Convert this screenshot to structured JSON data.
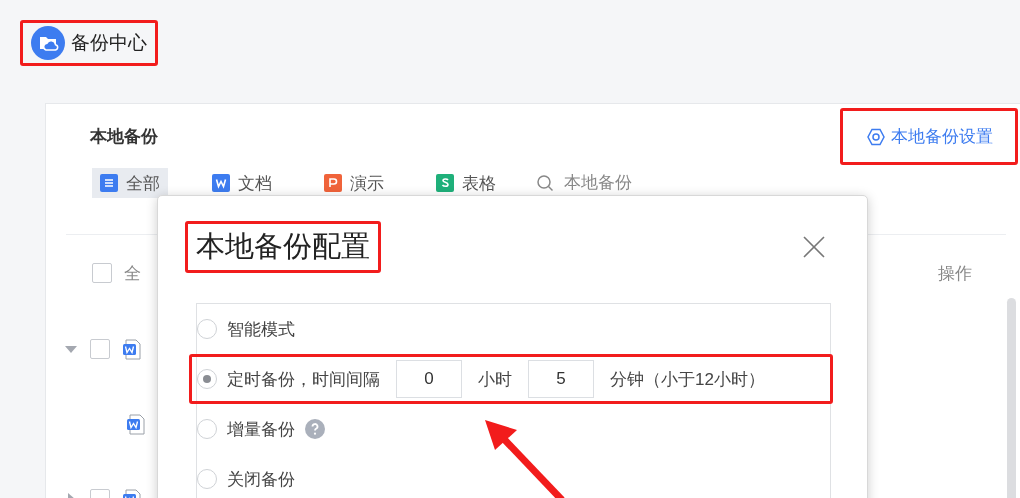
{
  "header": {
    "title": "备份中心",
    "highlighted": true
  },
  "panel": {
    "title": "本地备份",
    "settings_link": {
      "label": "本地备份设置",
      "highlighted": true
    },
    "tabs": [
      {
        "label": "全部",
        "kind": "all",
        "selected": true
      },
      {
        "label": "文档",
        "kind": "doc",
        "selected": false
      },
      {
        "label": "演示",
        "kind": "slides",
        "selected": false
      },
      {
        "label": "表格",
        "kind": "sheet",
        "selected": false
      }
    ],
    "search": {
      "placeholder": "本地备份"
    },
    "table": {
      "select_all": {
        "label": "全",
        "checked": false
      },
      "action_column": "操作",
      "rows": [
        {
          "expanded": true,
          "checked": false,
          "children": [
            {
              "kind": "doc"
            }
          ]
        },
        {
          "expanded": false,
          "checked": false
        }
      ]
    }
  },
  "dialog": {
    "title": "本地备份配置",
    "title_highlighted": true,
    "options": [
      {
        "kind": "plain",
        "label": "智能模式",
        "selected": false,
        "highlighted": false
      },
      {
        "kind": "interval",
        "label": "定时备份，时间间隔",
        "selected": true,
        "highlighted": true,
        "hours": "0",
        "hours_unit": "小时",
        "minutes": "5",
        "minutes_unit": "分钟（小于12小时）"
      },
      {
        "kind": "help",
        "label": "增量备份",
        "selected": false,
        "highlighted": false
      },
      {
        "kind": "plain",
        "label": "关闭备份",
        "selected": false,
        "highlighted": false
      }
    ]
  },
  "annotations": [
    {
      "kind": "arrow"
    }
  ]
}
